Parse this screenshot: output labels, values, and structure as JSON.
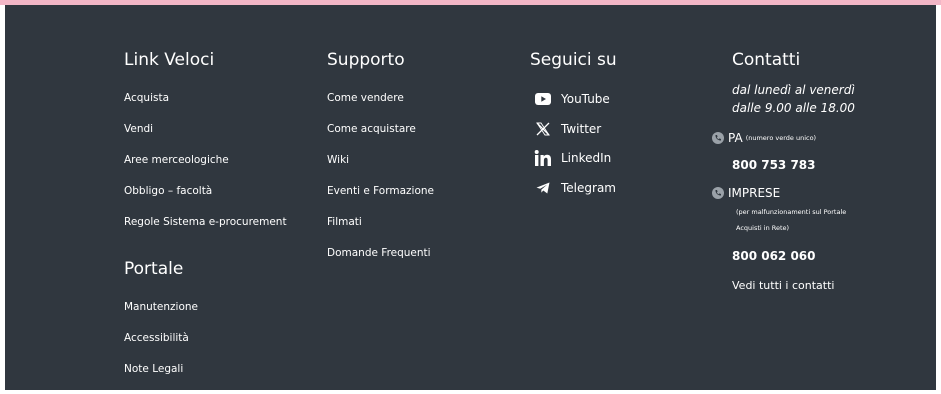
{
  "colors": {
    "top_bar": "#f2b6c6",
    "footer_bg": "#30373f",
    "text": "#ffffff",
    "phone_icon_bg": "#9aa1a8"
  },
  "quick_links": {
    "heading": "Link Veloci",
    "items": [
      "Acquista",
      "Vendi",
      "Aree merceologiche",
      "Obbligo – facoltà",
      "Regole Sistema e-procurement"
    ]
  },
  "portal": {
    "heading": "Portale",
    "items": [
      "Manutenzione",
      "Accessibilità",
      "Note Legali"
    ]
  },
  "support": {
    "heading": "Supporto",
    "items": [
      "Come vendere",
      "Come acquistare",
      "Wiki",
      "Eventi e Formazione",
      "Filmati",
      "Domande Frequenti"
    ]
  },
  "social": {
    "heading": "Seguici su",
    "items": [
      {
        "label": "YouTube",
        "icon": "youtube-icon"
      },
      {
        "label": "Twitter",
        "icon": "x-twitter-icon"
      },
      {
        "label": "LinkedIn",
        "icon": "linkedin-icon"
      },
      {
        "label": "Telegram",
        "icon": "telegram-icon"
      }
    ]
  },
  "contacts": {
    "heading": "Contatti",
    "hours_line1": "dal lunedì al venerdì",
    "hours_line2": "dalle 9.00 alle 18.00",
    "pa": {
      "label": "PA",
      "note": "(numero verde unico)",
      "number": "800 753 783"
    },
    "imprese": {
      "label": "IMPRESE",
      "note_line1": "(per malfunzionamenti sul Portale",
      "note_line2": "Acquisti in Rete)",
      "number": "800 062 060"
    },
    "all_contacts": "Vedi tutti i contatti"
  }
}
